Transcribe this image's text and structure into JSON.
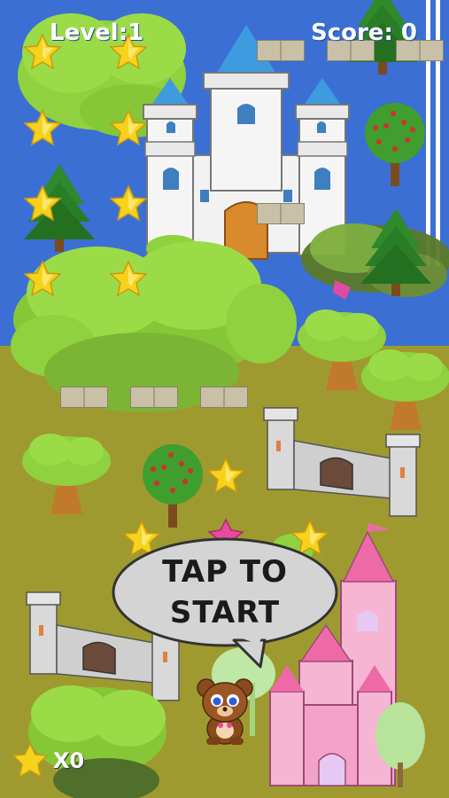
{
  "hud": {
    "level_label": "Level:",
    "level_value": "1",
    "score_label": "Score:",
    "score_value": "0"
  },
  "start_prompt": {
    "line1": "TAP TO",
    "line2": "START"
  },
  "collected": {
    "icon": "star-icon",
    "count": "X0"
  },
  "colors": {
    "sky": "#3b6fd4",
    "ground": "#9f9a2f",
    "star": "#f7d21c",
    "pink_castle": "#f3a3c8",
    "hud_text": "#ffffff"
  }
}
